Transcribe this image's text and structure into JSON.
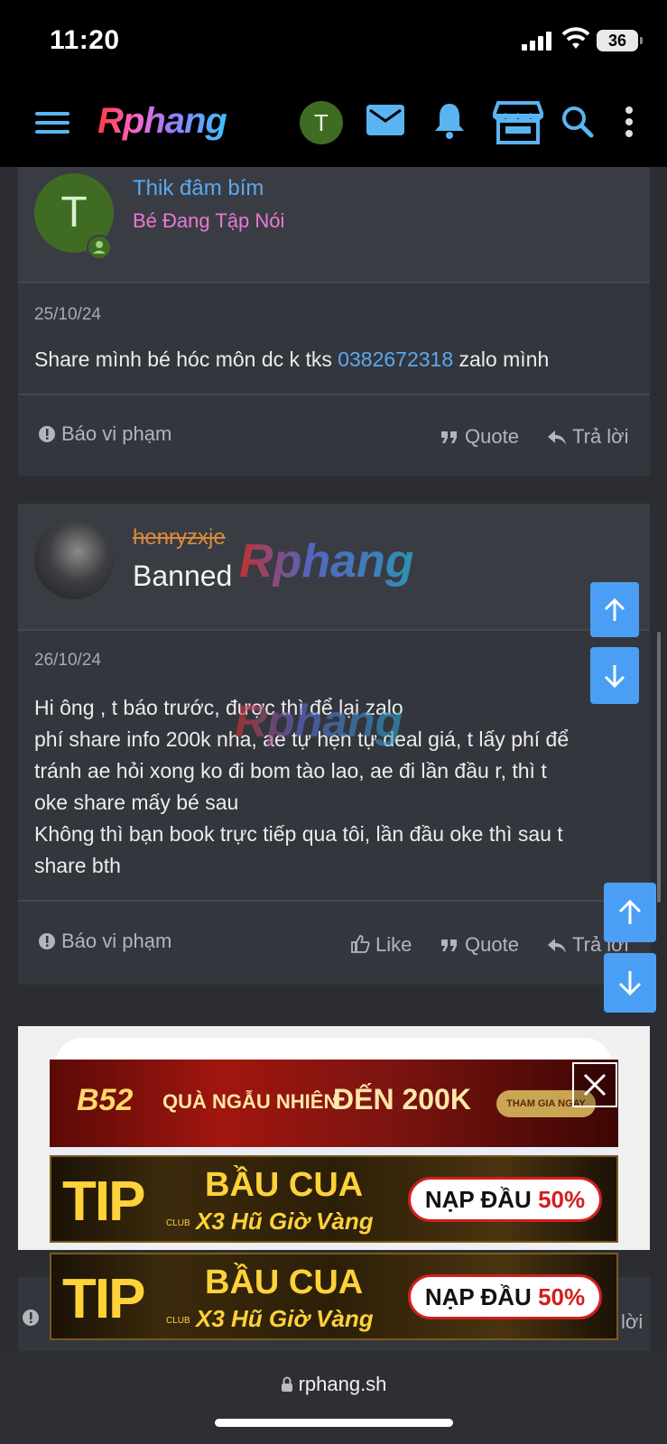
{
  "status_bar": {
    "time": "11:20",
    "battery": "36"
  },
  "nav": {
    "logo": "Rphang",
    "avatar_letter": "T"
  },
  "posts": [
    {
      "author": "Thik đâm bím",
      "user_title": "Bé Đang Tập Nói",
      "avatar_letter": "T",
      "date": "25/10/24",
      "body_prefix": "Share mình bé hóc môn dc k tks ",
      "body_link": "0382672318",
      "body_suffix": " zalo mình",
      "actions": {
        "report": "Báo vi phạm",
        "quote": "Quote",
        "reply": "Trả lời"
      }
    },
    {
      "author": "henryzxje",
      "user_title": "Banned",
      "date": "26/10/24",
      "body_lines": [
        "Hi ông , t báo trước, được thì để lại zalo",
        "phí share info 200k nha, ae tự hẹn tự deal giá, t lấy phí để",
        "tránh ae hỏi xong ko đi bom tào lao, ae đi lần đầu r, thì t",
        "oke share mấy bé sau",
        "Không thì bạn book trực tiếp qua tôi, lần đầu oke thì sau t",
        "share bth"
      ],
      "actions": {
        "report": "Báo vi phạm",
        "like": "Like",
        "quote": "Quote",
        "reply": "Trả lời"
      }
    }
  ],
  "watermark": "Rphang",
  "ads": {
    "b52": {
      "logo": "B52",
      "text1": "QUÀ NGẪU NHIÊN",
      "text2": "ĐẾN 200K",
      "cta": "THAM GIA NGAY"
    },
    "tip": {
      "logo": "TIP",
      "club": "CLUB",
      "title": "BẦU CUA",
      "subtitle": "X3 Hũ Giờ Vàng",
      "cta_prefix": "NẠP ĐẦU",
      "cta_pct": "50%"
    }
  },
  "footer_peek": {
    "reply": "lời"
  },
  "browser": {
    "url": "rphang.sh"
  },
  "colors": {
    "link": "#5aa9f0",
    "user_title_pink": "#e87ad6",
    "scroll_button": "#4a9ff5",
    "nav_icon": "#5ab4f2"
  }
}
